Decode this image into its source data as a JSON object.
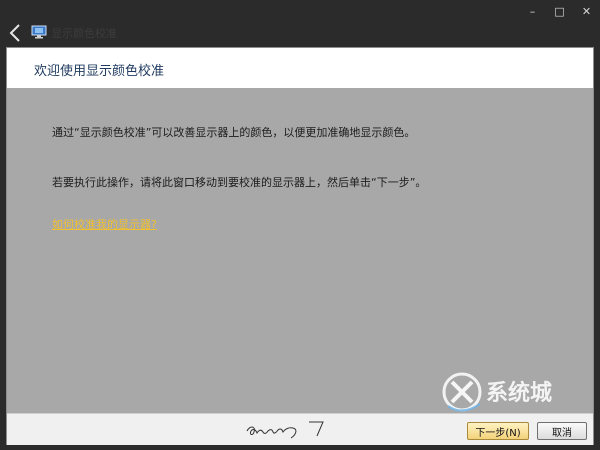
{
  "window": {
    "minimize_label": "–",
    "maximize_label": "□",
    "close_label": "✕"
  },
  "nav": {
    "title": "显示颜色校准"
  },
  "header": {
    "title": "欢迎使用显示颜色校准"
  },
  "content": {
    "line1": "通过“显示颜色校准”可以改善显示器上的颜色，以便更加准确地显示颜色。",
    "line2": "若要执行此操作，请将此窗口移动到要校准的显示器上，然后单击“下一步”。",
    "help_link": "如何校准我的显示器?"
  },
  "footer": {
    "next_label": "下一步(N)",
    "cancel_label": "取消"
  },
  "watermark": {
    "text": "系统城"
  },
  "colors": {
    "content_bg": "#a8a8a8",
    "title_text": "#1e3a5f",
    "link": "#f0c030"
  },
  "icons": {
    "back": "back-arrow-icon",
    "app": "monitor-icon"
  }
}
